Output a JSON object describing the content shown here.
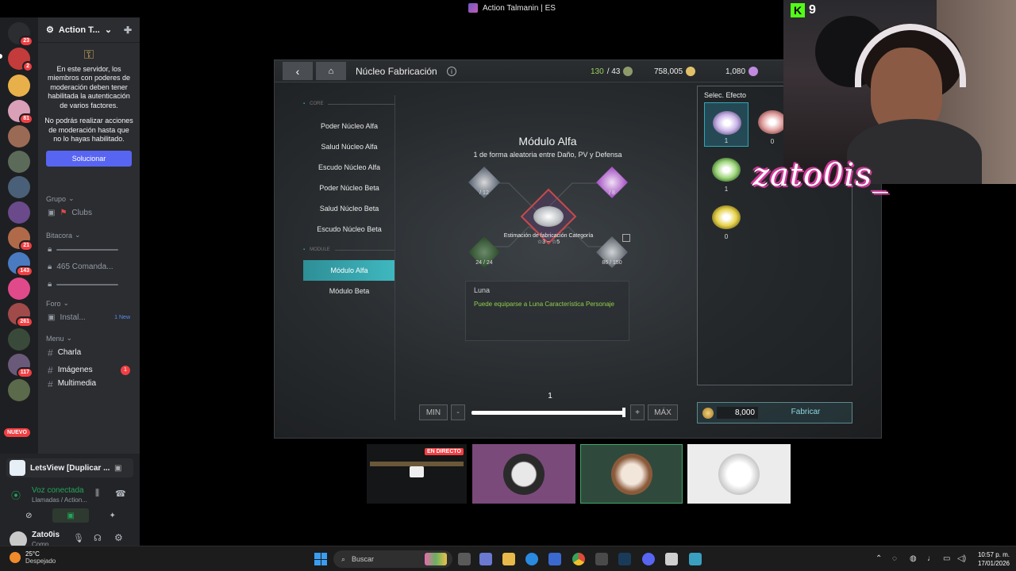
{
  "window_title": "Action Talmanin | ES",
  "rail": {
    "badges": [
      "23",
      "2",
      "81",
      "21",
      "143",
      "261",
      "117"
    ],
    "nuevo_label": "NUEVO"
  },
  "server": {
    "name": "Action T...",
    "notice_1": "En este servidor, los miembros con poderes de moderación deben tener habilitada la autenticación de varios factores.",
    "notice_2": "No podrás realizar acciones de moderación hasta que no lo hayas habilitado.",
    "fix_button": "Solucionar",
    "categories": {
      "grupo": "Grupo",
      "bitacora": "Bitacora",
      "foro": "Foro",
      "menu": "Menu"
    },
    "channels": {
      "clubs": "Clubs",
      "comanda": "465 Comanda...",
      "instal": "Instal...",
      "instal_new": "1 New",
      "charla": "Charla",
      "imagenes": "Imágenes",
      "imagenes_count": "1",
      "multimedia": "Multimedia"
    }
  },
  "userpanel": {
    "app_name": "LetsView [Duplicar ...",
    "voice_status": "Voz conectada",
    "voice_sub": "Llamadas / Action...",
    "username": "Zato0is",
    "user_status": "Comp..."
  },
  "game": {
    "title": "Núcleo Fabricación",
    "info_icon": "i",
    "currencies": [
      {
        "value": "130",
        "max": "/ 43",
        "color": "#b48ae0"
      },
      {
        "value": "758,005",
        "color": "#e2c06a"
      },
      {
        "value": "1,080",
        "color": "#c08ae0"
      }
    ],
    "menu": {
      "core_label": "CORE",
      "core_items": [
        "Poder Núcleo Alfa",
        "Salud Núcleo Alfa",
        "Escudo Núcleo Alfa",
        "Poder Núcleo Beta",
        "Salud Núcleo Beta",
        "Escudo Núcleo Beta"
      ],
      "module_label": "MODULE",
      "module_items": [
        "Módulo Alfa",
        "Módulo Beta"
      ]
    },
    "module_title": "Módulo Alfa",
    "module_subtitle": "1 de forma aleatoria entre Daño, PV y Defensa",
    "materials": [
      {
        "count": "/ 12"
      },
      {
        "count": "/ 8"
      },
      {
        "count": "24 / 24"
      },
      {
        "count": "86 / 150"
      }
    ],
    "estimate_label": "Estimación de fabricación Categoría",
    "estimate_range": "☆3 ~ ☆5",
    "desc_name": "Luna",
    "desc_text": "Puede equiparse a Luna Característica Personaje",
    "quantity": {
      "min_label": "MIN",
      "minus": "-",
      "plus": "+",
      "max_label": "MÁX",
      "value": "1"
    },
    "effect_title": "Selec. Efecto",
    "effects": [
      {
        "count": "1",
        "color": "#c9b4e8"
      },
      {
        "count": "0",
        "color": "#e0a0a0"
      },
      {
        "count": "1",
        "color": "#9ed67a"
      },
      {
        "count": "0",
        "color": "#e6d24a"
      }
    ],
    "craft_cost": "8,000",
    "craft_label": "Fabricar"
  },
  "stream": {
    "platform_letter": "K",
    "viewers": "9",
    "overlay_name": "zato0is_",
    "live_label": "EN DIRECTO"
  },
  "taskbar": {
    "temperature": "25°C",
    "weather": "Despejado",
    "search_placeholder": "Buscar",
    "time": "10:57 p. m.",
    "date": "17/01/2026"
  }
}
